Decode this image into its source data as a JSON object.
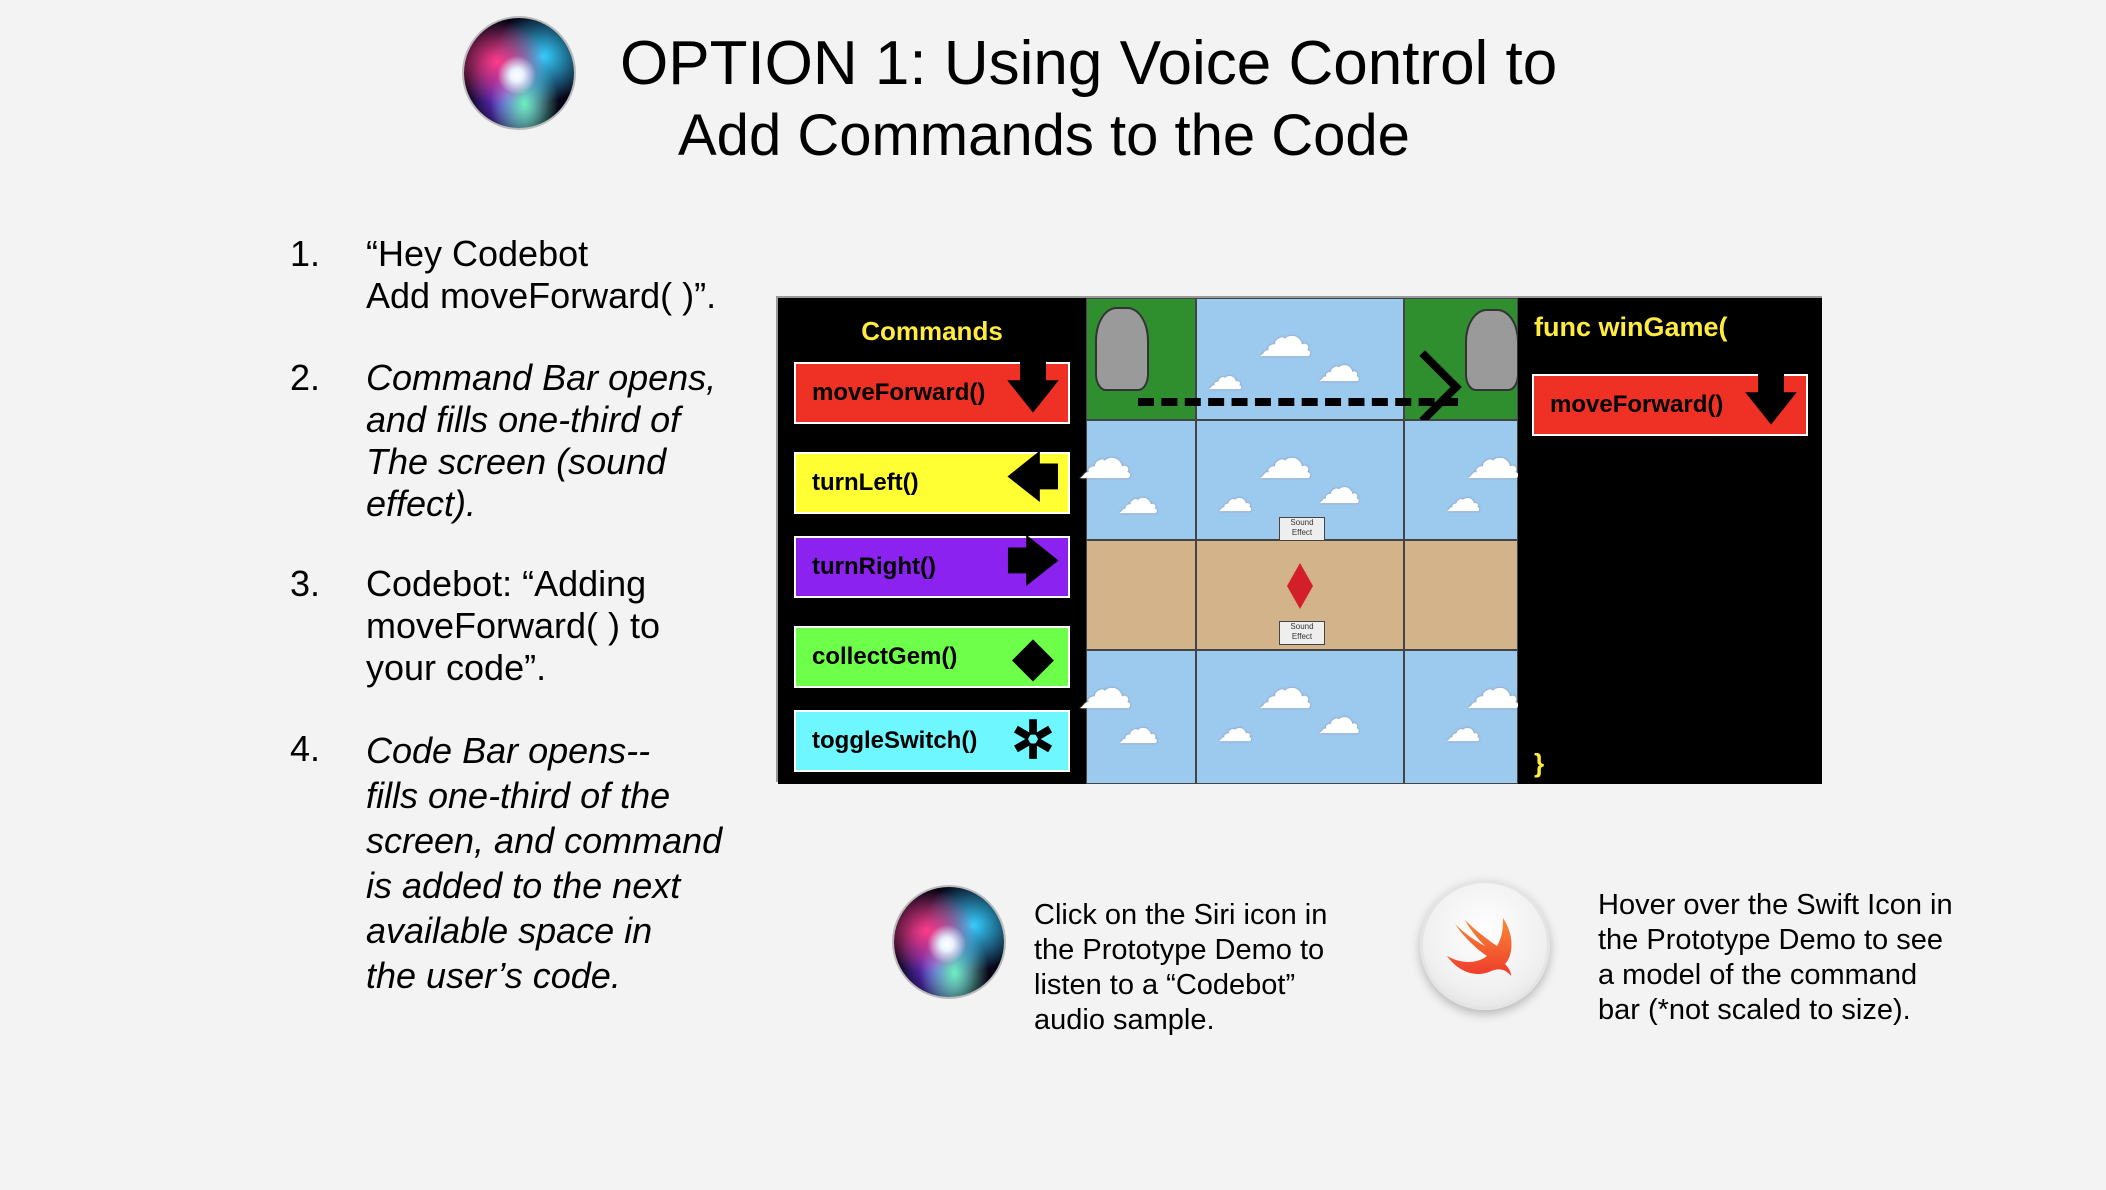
{
  "title": {
    "line1": "OPTION 1: Using Voice Control to",
    "line2": "Add Commands to the Code"
  },
  "steps": [
    {
      "num": "1.",
      "text": "“Hey Codebot\nAdd moveForward( )”.",
      "italic": false
    },
    {
      "num": "2.",
      "text": "Command Bar opens,\nand fills one-third of\nThe screen (sound\neffect).",
      "italic": true
    },
    {
      "num": "3.",
      "text": "Codebot: “Adding\nmoveForward( ) to\nyour code”.",
      "italic": false
    },
    {
      "num": "4.",
      "text": "Code Bar opens--\nfills one-third of the\nscreen, and command\nis added to the next\navailable space in\nthe user’s code.",
      "italic": true
    }
  ],
  "game": {
    "commands_title": "Commands",
    "commands": [
      {
        "label": "moveForward()",
        "color": "#ee3124",
        "icon": "down-arrow-icon",
        "glyph": "🡇"
      },
      {
        "label": "turnLeft()",
        "color": "#ffff33",
        "icon": "left-arrow-icon",
        "glyph": "🡄"
      },
      {
        "label": "turnRight()",
        "color": "#8b22f0",
        "icon": "right-arrow-icon",
        "glyph": "🡆"
      },
      {
        "label": "collectGem()",
        "color": "#6eff4a",
        "icon": "gem-icon",
        "glyph": "◆"
      },
      {
        "label": "toggleSwitch()",
        "color": "#6ff7ff",
        "icon": "aperture-icon",
        "glyph": "✲"
      }
    ],
    "sound_label": "Sound Effect",
    "code_title": "func winGame(",
    "code_command": "moveForward()",
    "code_command_color": "#ee3124",
    "code_close": "}"
  },
  "notes": {
    "siri": "Click on the Siri icon in\nthe Prototype Demo to\nlisten to a “Codebot”\naudio sample.",
    "swift": "Hover over the Swift Icon in\nthe Prototype Demo to see\na model of the command\nbar (*not scaled to size)."
  }
}
